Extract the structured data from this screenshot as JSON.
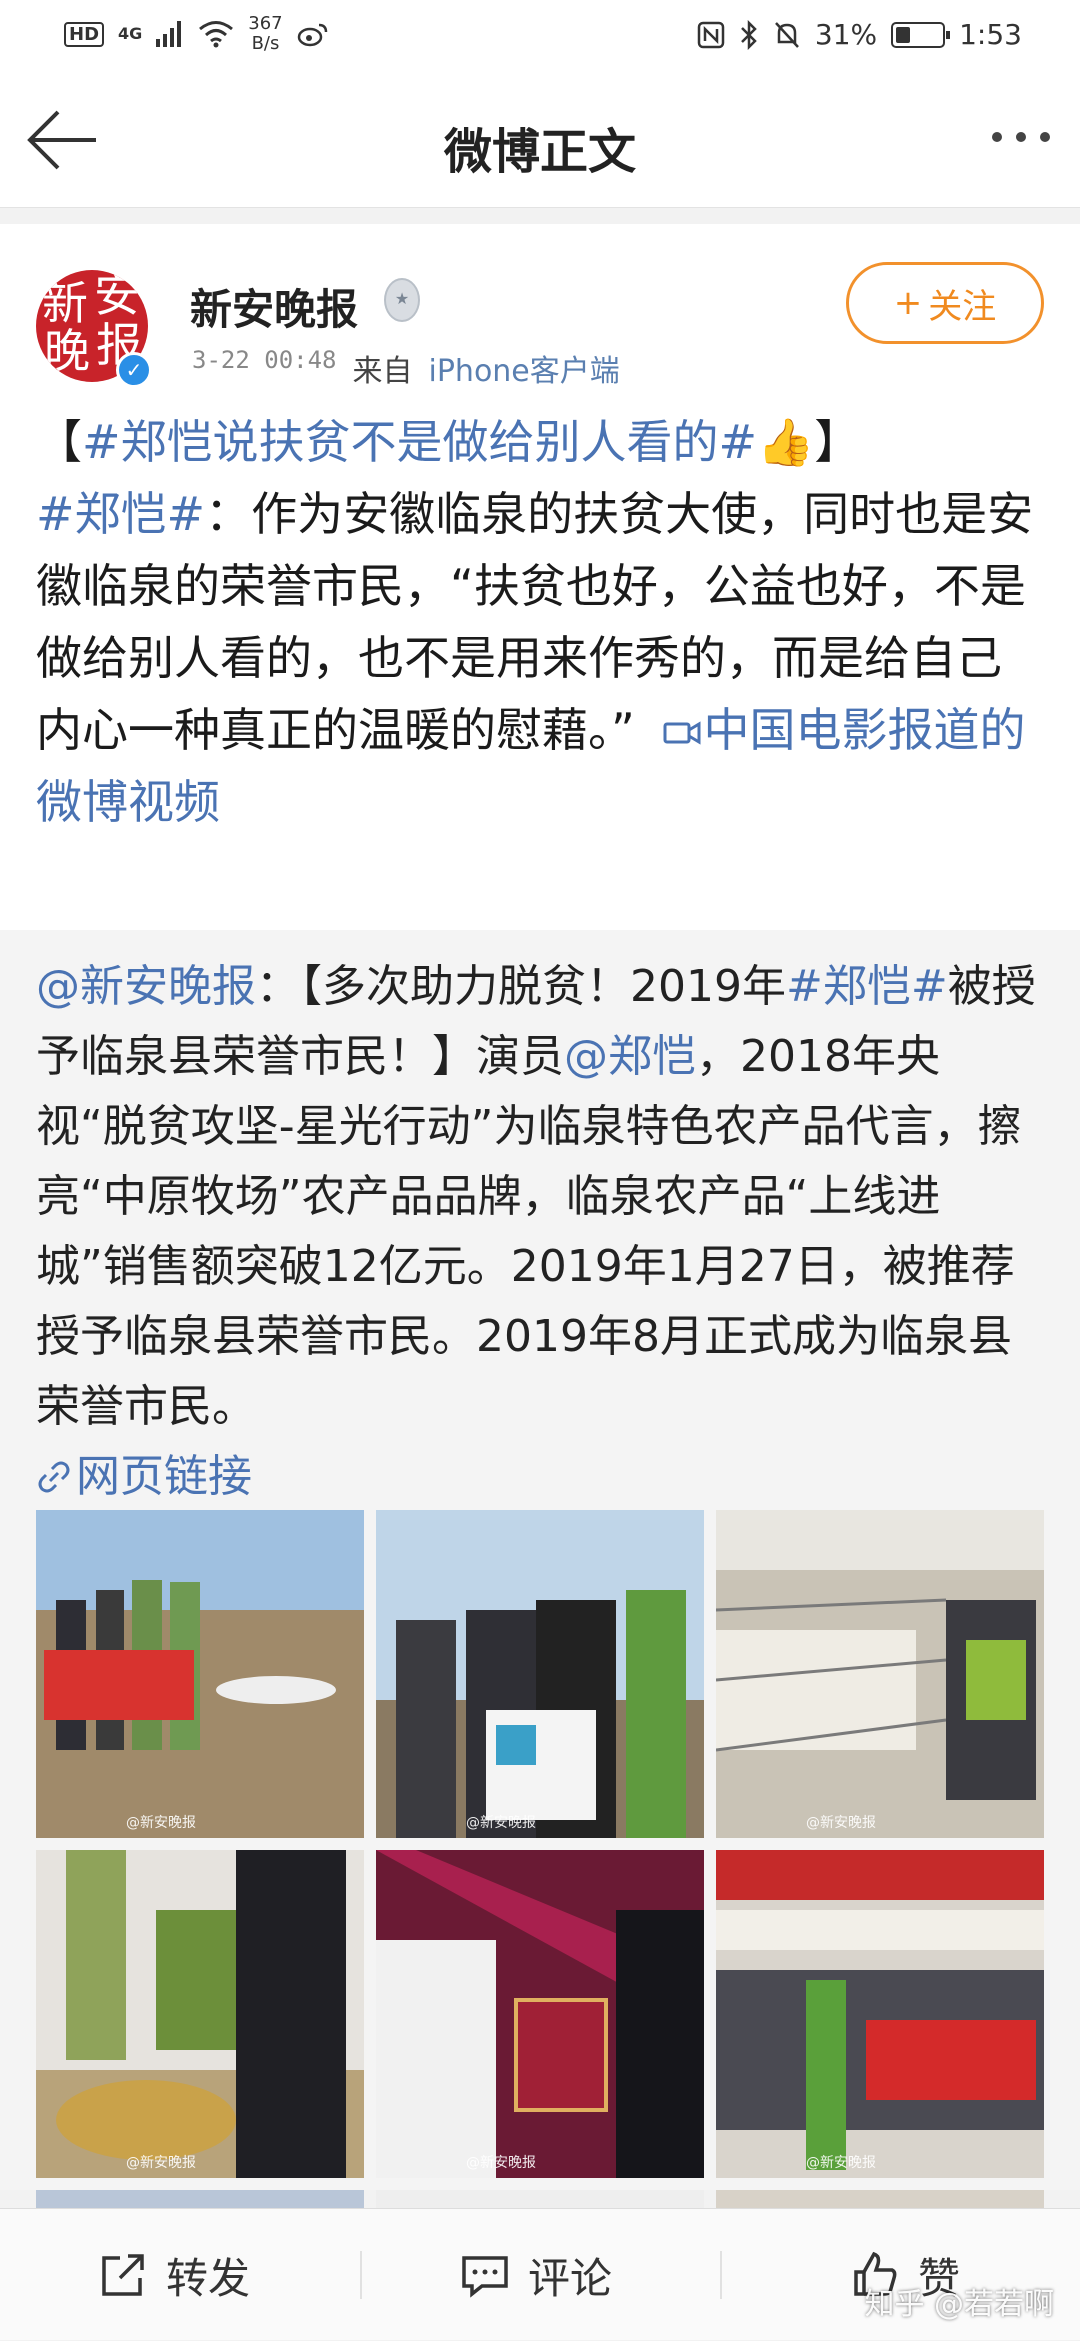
{
  "status_bar": {
    "hd": "HD",
    "network": "4G",
    "speed_value": "367",
    "speed_unit": "B/s",
    "battery": "31%",
    "battery_level": 0.31,
    "time": "1:53"
  },
  "nav": {
    "title": "微博正文"
  },
  "post": {
    "author": "新安晚报",
    "avatar_chars": [
      "新",
      "安",
      "晚",
      "报"
    ],
    "time": "3-22 00:48",
    "from": "来自",
    "client": "iPhone客户端",
    "follow": "关注",
    "follow_plus": "+",
    "text": {
      "bracket_open": "【",
      "hashtag_title": "#郑恺说扶贫不是做给别人看的#",
      "thumb": "👍",
      "bracket_close": "】",
      "mention_tag": "#郑恺#",
      "body": "：作为安徽临泉的扶贫大使，同时也是安徽临泉的荣誉市民，“扶贫也好，公益也好，不是做给别人看的，也不是用来作秀的，而是给自己内心一种真正的温暖的慰藉。”",
      "video_link": "中国电影报道的微博视频"
    }
  },
  "repost": {
    "mention": "@新安晚报",
    "seg1": "：【多次助力脱贫！2019年",
    "tag": "#郑恺#",
    "seg2": "被授予临泉县荣誉市民！】演员",
    "mention2": "@郑恺",
    "seg3": "，2018年央视“脱贫攻坚-星光行动”为临泉特色农产品代言，擦亮“中原牧场”农产品品牌，临泉农产品“上线进城”销售额突破12亿元。2019年1月27日，被推荐授予临泉县荣誉市民。2019年8月正式成为临泉县荣誉市民。",
    "web_link": "网页链接",
    "watermark": "@新安晚报"
  },
  "bottom_bar": {
    "forward": "转发",
    "comment": "评论",
    "like": "赞",
    "zhihu": "知乎 @若若啊"
  },
  "colors": {
    "link": "#4a73b3",
    "follow": "#f08a1f",
    "avatar_red": "#c8232a"
  }
}
